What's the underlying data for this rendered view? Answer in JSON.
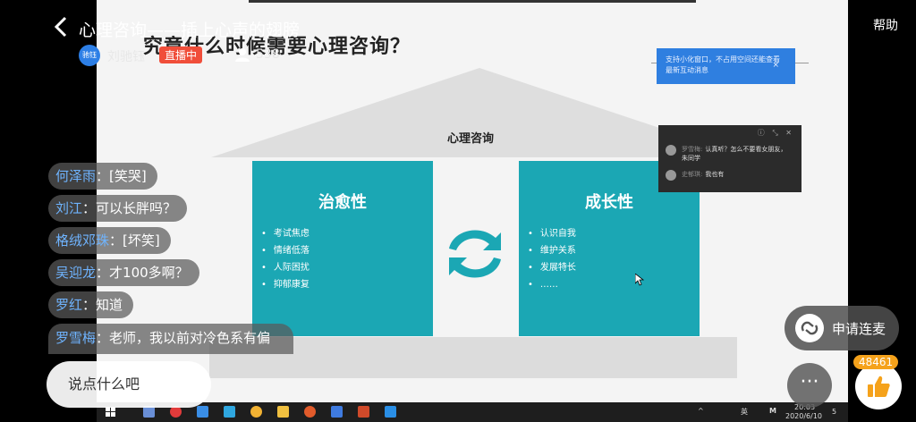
{
  "header": {
    "title": "心理咨询——插上心声的翅膀",
    "help_label": "帮助",
    "host_avatar_text": "驰钰",
    "host_name": "刘驰钰",
    "live_badge": "直播中",
    "viewer_count": "538"
  },
  "slide": {
    "title": "究竟什么时候需要心理咨询？",
    "roof_label": "心理咨询",
    "left_pillar": {
      "heading": "治愈性",
      "items": [
        "考试焦虑",
        "情绪低落",
        "人际困扰",
        "抑郁康复"
      ]
    },
    "right_pillar": {
      "heading": "成长性",
      "items": [
        "认识自我",
        "维护关系",
        "发展特长",
        "……"
      ]
    },
    "tip_popup": {
      "text": "支持小化窗口，不占用空间还能查看最新互动消息",
      "close": "×"
    },
    "chat_popup": {
      "controls": "ⓘ ⤡ ✕",
      "rows": [
        {
          "name": "罗雪梅:",
          "text": "认真听？怎么不要看女朋友，朱同学"
        },
        {
          "name": "史郁琪:",
          "text": "我也有"
        }
      ]
    }
  },
  "taskbar": {
    "time": "20:03",
    "date": "2020/6/10",
    "ime": "英",
    "notif_count": "5"
  },
  "comments": [
    {
      "user": "何泽雨",
      "text": "[笑哭]"
    },
    {
      "user": "刘江",
      "text": "可以长胖吗？"
    },
    {
      "user": "格绒邓珠",
      "text": "[坏笑]"
    },
    {
      "user": "吴迎龙",
      "text": "才100多啊？"
    },
    {
      "user": "罗红",
      "text": "知道"
    },
    {
      "user": "罗雪梅",
      "text": "老师，我以前对冷色系有偏执，所有的衣物都是黑灰那"
    }
  ],
  "bottom": {
    "input_placeholder": "说点什么吧",
    "mic_label": "申请连麦",
    "more_label": "···",
    "like_count": "48461"
  }
}
